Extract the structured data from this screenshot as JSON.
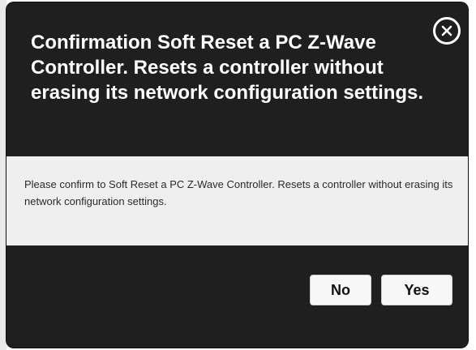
{
  "dialog": {
    "title": "Confirmation Soft Reset a PC Z-Wave Controller. Resets a controller without erasing its network configuration settings.",
    "message": "Please confirm to Soft Reset a PC Z-Wave Controller. Resets a controller without erasing its network configuration settings.",
    "buttons": {
      "no_label": "No",
      "yes_label": "Yes"
    },
    "close_icon": "close-icon"
  },
  "colors": {
    "dialog_background": "#1f1f1f",
    "body_background": "#efefef",
    "button_background": "#f7f7f7",
    "title_text": "#ffffff",
    "message_text": "#2a2a2a"
  }
}
